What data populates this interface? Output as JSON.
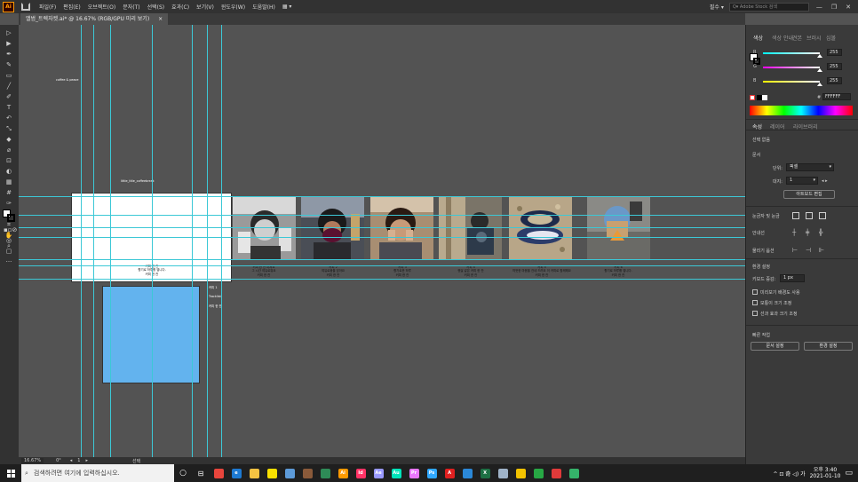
{
  "app": {
    "logo": "Ai",
    "workspace": "필수",
    "stock_placeholder": "Adobe Stock 검색"
  },
  "menu": [
    "파일(F)",
    "편집(E)",
    "오브젝트(O)",
    "문자(T)",
    "선택(S)",
    "효과(C)",
    "보기(V)",
    "윈도우(W)",
    "도움말(H)"
  ],
  "document": {
    "tab_title": "앨범_트렉자켓.ai* @ 16.67% (RGB/GPU 미리 보기)",
    "close": "×"
  },
  "status": {
    "zoom": "16.67%",
    "angle": "0°",
    "page": "1",
    "mode": "선택"
  },
  "canvas": {
    "top_label": "coffee & peace",
    "artboard_label": "little_title_coffeebreak",
    "artboard_caption": [
      "커피 한 잔",
      "향기로 하루를 엽니다.",
      "커피 한 잔"
    ],
    "side_text": [
      "커피 1",
      "Tracklist",
      "커피 한 잔"
    ],
    "captions": [
      [
        "커피 한 잔 마셔요",
        "그 시간 여유로워요",
        "커피 한 잔"
      ],
      [
        "커피 2",
        "여유로움을 담아요",
        "커피 한 잔"
      ],
      [
        "커피 3",
        "향기로운 하루",
        "커피 한 잔"
      ],
      [
        "커피 4",
        "햇살 같은 커피 한 잔",
        "커피 한 잔"
      ],
      [
        "커피 5",
        "따뜻한 마음을 건네 드려요 이 커피로 함께해요",
        "커피 한 잔"
      ],
      [
        "커피 6",
        "향기로 하루를 엽니다.",
        "커피 한 잔"
      ]
    ]
  },
  "panel": {
    "color_tabs": [
      "색상",
      "색상 안내",
      "견본",
      "브러시",
      "심볼"
    ],
    "channels": [
      {
        "label": "R",
        "value": "255"
      },
      {
        "label": "G",
        "value": "255"
      },
      {
        "label": "B",
        "value": "255"
      }
    ],
    "hex_prefix": "#",
    "hex": "FFFFFF",
    "props_tabs": [
      "속성",
      "레이어",
      "라이브러리"
    ],
    "no_selection": "선택 없음",
    "document_header": "문서",
    "units_label": "단위:",
    "units_value": "픽셀",
    "artboard_label": "대지:",
    "artboard_value": "1",
    "edit_artboards": "아트보드 편집",
    "rulers_grids": "눈금자 및 눈금",
    "guides": "안내선",
    "snap": "물리기 옵션",
    "prefs_header": "환경 설정",
    "keyboard_increment_label": "키보드 증감:",
    "keyboard_increment_value": "1 px",
    "checkboxes": [
      "미리보기 배경도 사용",
      "모퉁이 크기 조정",
      "선과 효과 크기 조정"
    ],
    "quick_actions": "빠른 작업",
    "document_setup": "문서 설정",
    "preferences": "환경 설정"
  },
  "taskbar": {
    "search_placeholder": "검색하려면 여기에 입력하십시오.",
    "apps": [
      {
        "name": "chrome",
        "label": "",
        "color": "#e8453c"
      },
      {
        "name": "edge",
        "label": "e",
        "color": "#1e7ad2"
      },
      {
        "name": "files",
        "label": "",
        "color": "#f5c242"
      },
      {
        "name": "kakao",
        "label": "",
        "color": "#f9e000"
      },
      {
        "name": "notepad",
        "label": "",
        "color": "#5d9ad8"
      },
      {
        "name": "game",
        "label": "",
        "color": "#8a5a3a"
      },
      {
        "name": "app-green",
        "label": "",
        "color": "#2e8b57"
      },
      {
        "name": "illustrator",
        "label": "Ai",
        "color": "#ff9a00"
      },
      {
        "name": "indesign",
        "label": "Id",
        "color": "#ff3366"
      },
      {
        "name": "after-effects",
        "label": "Ae",
        "color": "#9999ff"
      },
      {
        "name": "audition",
        "label": "Au",
        "color": "#00e4bb"
      },
      {
        "name": "premiere",
        "label": "Pr",
        "color": "#ea77ff"
      },
      {
        "name": "photoshop",
        "label": "Ps",
        "color": "#31a8ff"
      },
      {
        "name": "acrobat",
        "label": "A",
        "color": "#e02020"
      },
      {
        "name": "app-blue",
        "label": "",
        "color": "#2b88d8"
      },
      {
        "name": "excel",
        "label": "X",
        "color": "#1d7044"
      },
      {
        "name": "app-bag",
        "label": "",
        "color": "#9fb3c8"
      },
      {
        "name": "app-yellow",
        "label": "",
        "color": "#f2c200"
      },
      {
        "name": "app-green2",
        "label": "",
        "color": "#27a844"
      },
      {
        "name": "app-red",
        "label": "",
        "color": "#e03a3a"
      },
      {
        "name": "app-green3",
        "label": "",
        "color": "#35b36a"
      }
    ],
    "tray": "^ ⊡ 奇 ◁) 가",
    "time": "오후 3:40",
    "date": "2021-01-10"
  }
}
